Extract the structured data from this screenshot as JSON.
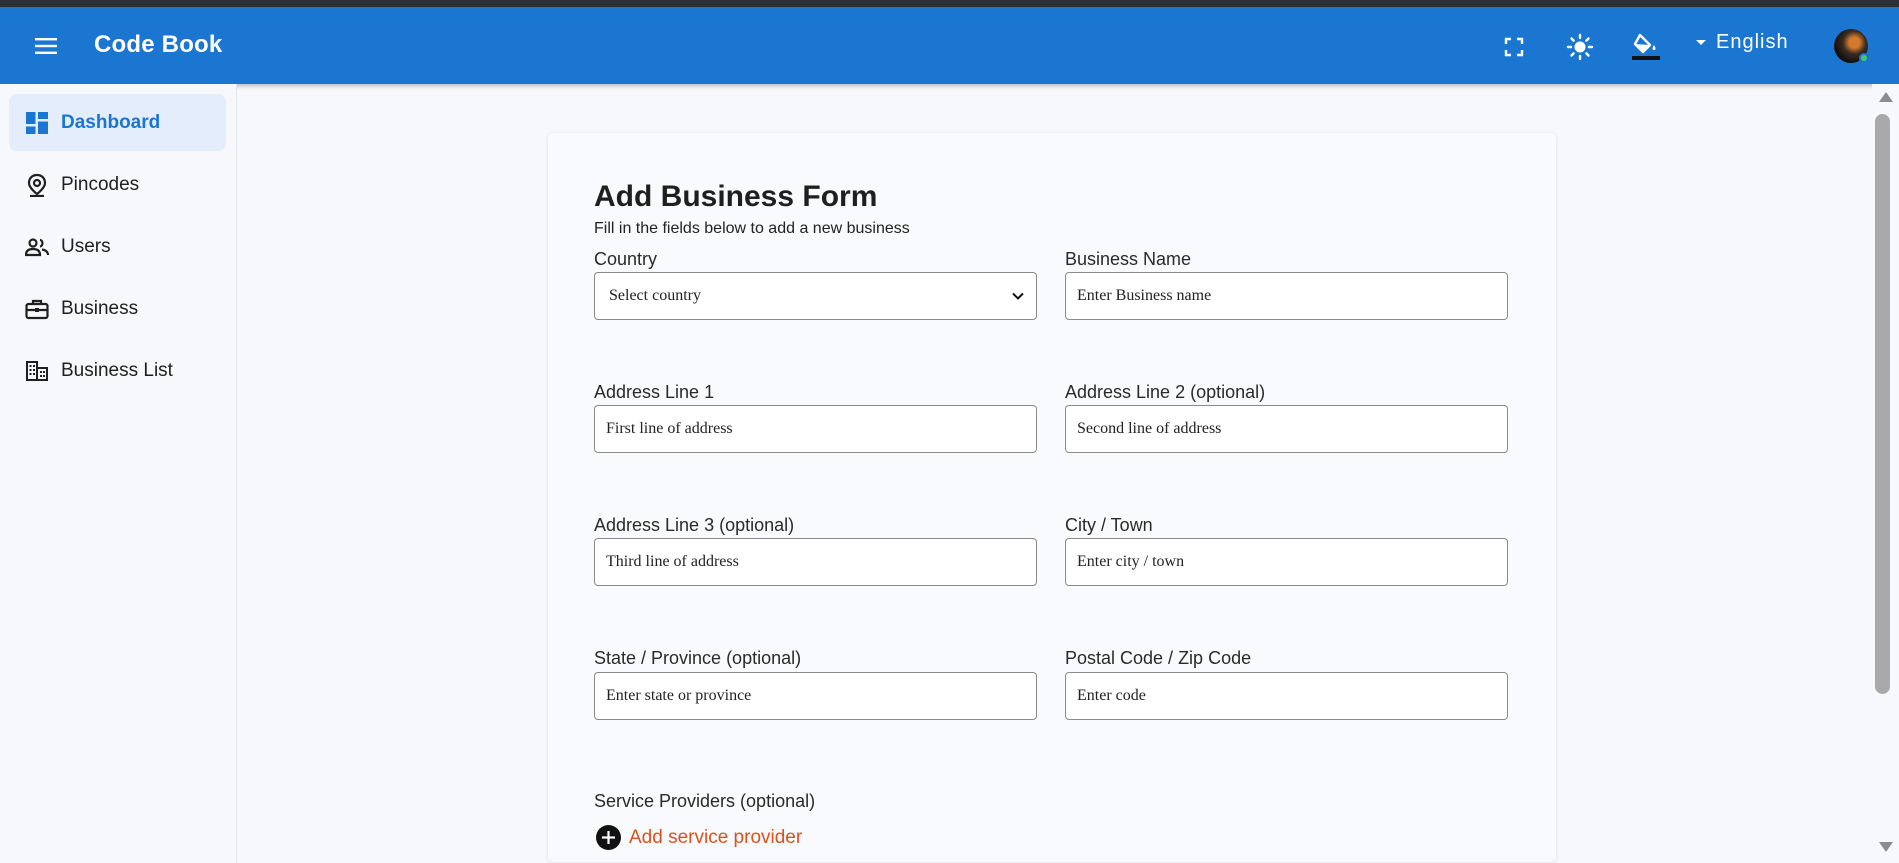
{
  "app": {
    "title": "Code Book",
    "language": "English",
    "colors": {
      "appbar": "#1b76d2",
      "accent": "#1b76d2",
      "link": "#d9531e",
      "active_nav_bg": "#e3edfb"
    }
  },
  "header_icons": [
    "menu-icon",
    "fullscreen-icon",
    "sun-icon",
    "paint-bucket-icon",
    "caret-down-icon",
    "avatar"
  ],
  "sidebar": {
    "items": [
      {
        "label": "Dashboard",
        "icon": "dashboard-icon",
        "active": true
      },
      {
        "label": "Pincodes",
        "icon": "location-pin-icon",
        "active": false
      },
      {
        "label": "Users",
        "icon": "users-icon",
        "active": false
      },
      {
        "label": "Business",
        "icon": "briefcase-icon",
        "active": false
      },
      {
        "label": "Business List",
        "icon": "building-icon",
        "active": false
      }
    ]
  },
  "form": {
    "title": "Add Business Form",
    "subtitle": "Fill in the fields below to add a new business",
    "country": {
      "label": "Country",
      "value": "Select country"
    },
    "business_name": {
      "label": "Business Name",
      "placeholder": "Enter Business name"
    },
    "address1": {
      "label": "Address Line 1",
      "placeholder": "First line of address"
    },
    "address2": {
      "label": "Address Line 2 (optional)",
      "placeholder": "Second line of address"
    },
    "address3": {
      "label": "Address Line 3 (optional)",
      "placeholder": "Third line of address"
    },
    "city": {
      "label": "City / Town",
      "placeholder": "Enter city / town"
    },
    "state": {
      "label": "State / Province (optional)",
      "placeholder": "Enter state or province"
    },
    "postal": {
      "label": "Postal Code / Zip Code",
      "placeholder": "Enter code"
    },
    "service_providers": {
      "label": "Service Providers (optional)",
      "add_label": "Add service provider"
    }
  }
}
